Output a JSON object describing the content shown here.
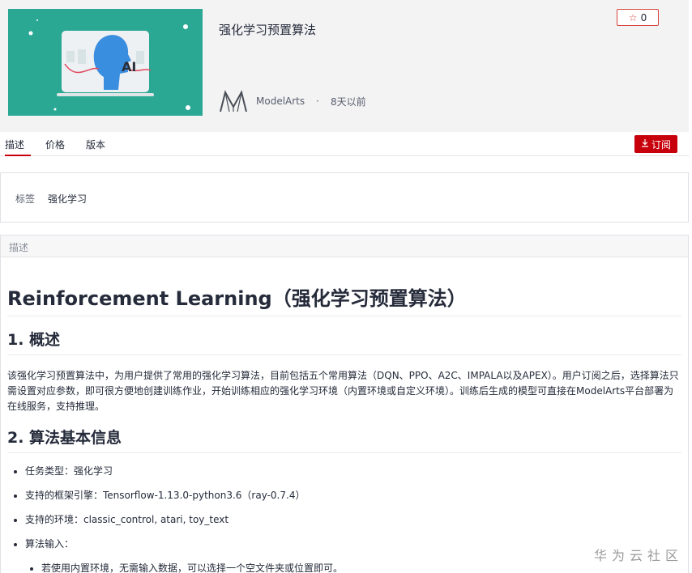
{
  "header": {
    "title": "强化学习预置算法",
    "star_count": "0",
    "publisher": "ModelArts",
    "separator": "·",
    "time": "8天以前",
    "cover_label": "AI"
  },
  "tabs": [
    {
      "label": "描述"
    },
    {
      "label": "价格"
    },
    {
      "label": "版本"
    }
  ],
  "subscribe_label": "订阅",
  "tags": {
    "label": "标签",
    "value": "强化学习"
  },
  "description": {
    "header": "描述",
    "h1": "Reinforcement Learning（强化学习预置算法）",
    "section1_title": "1. 概述",
    "section1_text": "该强化学习预置算法中，为用户提供了常用的强化学习算法，目前包括五个常用算法（DQN、PPO、A2C、IMPALA以及APEX）。用户订阅之后，选择算法只需设置对应参数，即可很方便地创建训练作业，开始训练相应的强化学习环境（内置环境或自定义环境）。训练后生成的模型可直接在ModelArts平台部署为在线服务，支持推理。",
    "section2_title": "2. 算法基本信息",
    "items": [
      "任务类型：强化学习",
      "支持的框架引擎：Tensorflow-1.13.0-python3.6（ray-0.7.4）",
      "支持的环境：classic_control, atari, toy_text",
      "算法输入："
    ],
    "sub_items": [
      "若使用内置环境，无需输入数据，可以选择一个空文件夹或位置即可。"
    ]
  },
  "watermark": "华为云社区",
  "colors": {
    "accent": "#c7000b",
    "cover_bg": "#2aa893",
    "header_bg": "#f3f3f4"
  }
}
